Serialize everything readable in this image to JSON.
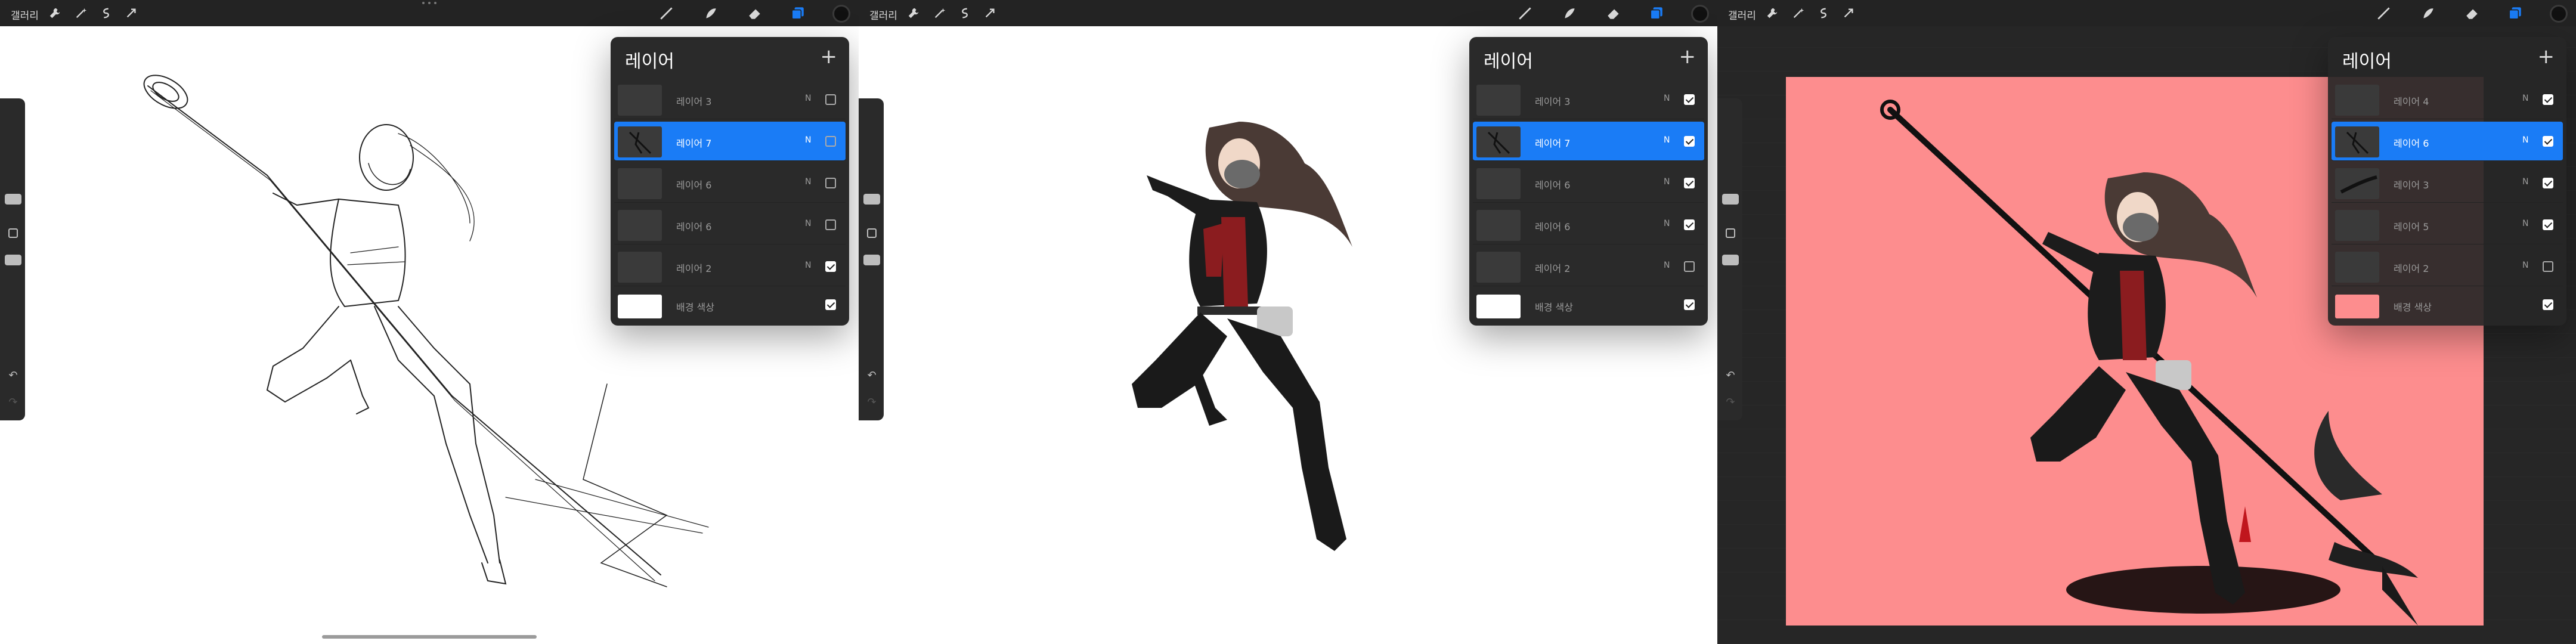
{
  "panels": [
    {
      "gallery": "갤러리",
      "layers_title": "레이어",
      "add_symbol": "+",
      "layers": [
        {
          "name": "레이어 3",
          "mode": "N",
          "visible": false,
          "selected": false
        },
        {
          "name": "레이어 7",
          "mode": "N",
          "visible": false,
          "selected": true
        },
        {
          "name": "레이어 6",
          "mode": "N",
          "visible": false,
          "selected": false
        },
        {
          "name": "레이어 6",
          "mode": "N",
          "visible": false,
          "selected": false
        },
        {
          "name": "레이어 2",
          "mode": "N",
          "visible": true,
          "selected": false
        }
      ],
      "background": {
        "name": "배경 색상",
        "color": "#ffffff",
        "visible": true
      }
    },
    {
      "gallery": "갤러리",
      "layers_title": "레이어",
      "add_symbol": "+",
      "layers": [
        {
          "name": "레이어 3",
          "mode": "N",
          "visible": true,
          "selected": false
        },
        {
          "name": "레이어 7",
          "mode": "N",
          "visible": true,
          "selected": true
        },
        {
          "name": "레이어 6",
          "mode": "N",
          "visible": true,
          "selected": false
        },
        {
          "name": "레이어 6",
          "mode": "N",
          "visible": true,
          "selected": false
        },
        {
          "name": "레이어 2",
          "mode": "N",
          "visible": false,
          "selected": false
        }
      ],
      "background": {
        "name": "배경 색상",
        "color": "#ffffff",
        "visible": true
      }
    },
    {
      "gallery": "갤러리",
      "layers_title": "레이어",
      "add_symbol": "+",
      "layers": [
        {
          "name": "레이어 4",
          "mode": "N",
          "visible": true,
          "selected": false
        },
        {
          "name": "레이어 6",
          "mode": "N",
          "visible": true,
          "selected": true
        },
        {
          "name": "레이어 3",
          "mode": "N",
          "visible": true,
          "selected": false
        },
        {
          "name": "레이어 5",
          "mode": "N",
          "visible": true,
          "selected": false
        },
        {
          "name": "레이어 2",
          "mode": "N",
          "visible": false,
          "selected": false
        }
      ],
      "background": {
        "name": "배경 색상",
        "color": "#fd8d8e",
        "visible": true
      }
    }
  ],
  "colors": {
    "accent": "#1a7cf6",
    "toolbar": "#232323",
    "panel": "#2a2a2a",
    "pink_canvas": "#fd8d8e"
  },
  "icons": {
    "left_tools": [
      "wrench-icon",
      "magic-wand-icon",
      "selection-icon",
      "transform-arrow-icon"
    ],
    "right_tools": [
      "brush-icon",
      "smudge-icon",
      "eraser-icon",
      "layers-icon",
      "color-icon"
    ]
  }
}
